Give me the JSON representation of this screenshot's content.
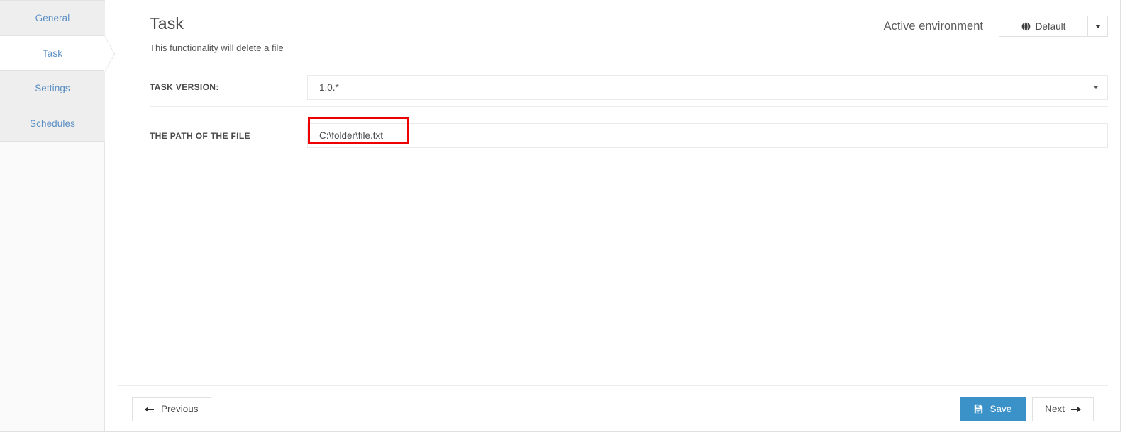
{
  "sidebar": {
    "items": [
      {
        "label": "General",
        "active": false
      },
      {
        "label": "Task",
        "active": true
      },
      {
        "label": "Settings",
        "active": false
      },
      {
        "label": "Schedules",
        "active": false
      }
    ]
  },
  "header": {
    "title": "Task",
    "subtitle": "This functionality will delete a file",
    "environment_label": "Active environment",
    "environment_value": "Default",
    "environment_icon": "globe-icon",
    "environment_caret_icon": "chevron-down-icon"
  },
  "form": {
    "fields": [
      {
        "label": "TASK VERSION:",
        "type": "select",
        "value": "1.0.*",
        "caret_icon": "chevron-down-icon"
      },
      {
        "label": "THE PATH OF THE FILE",
        "type": "text",
        "value": "C:\\folder\\file.txt",
        "placeholder": "",
        "highlighted": true
      }
    ]
  },
  "footer": {
    "previous_label": "Previous",
    "previous_icon": "arrow-left-icon",
    "save_label": "Save",
    "save_icon": "floppy-disk-icon",
    "next_label": "Next",
    "next_icon": "arrow-right-icon"
  },
  "colors": {
    "accent": "#3a92c8",
    "nav_text": "#5a8fc4",
    "annotation": "#ee0000",
    "nav_bg": "#eeeeee",
    "sidebar_bg": "#fafafa"
  }
}
